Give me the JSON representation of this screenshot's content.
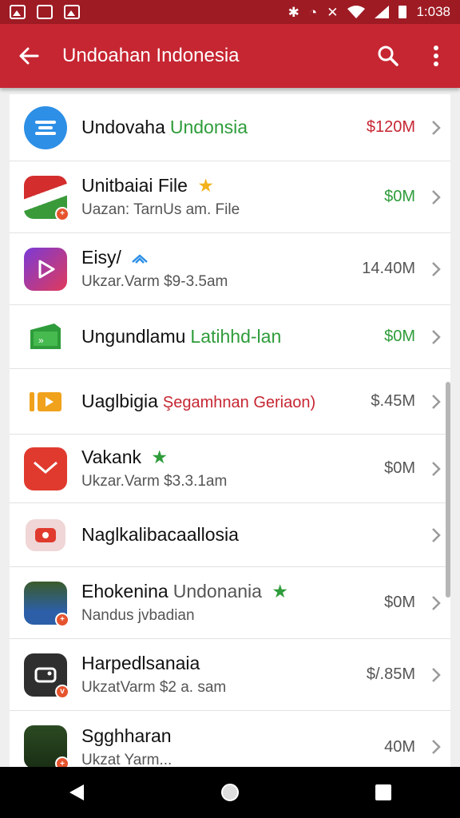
{
  "status_bar": {
    "time": "1:038",
    "icons": [
      "image-icon",
      "chat-icon",
      "photo-icon",
      "bluetooth-icon",
      "alarm-icon",
      "vibrate-icon",
      "wifi-icon",
      "signal-icon",
      "battery-icon"
    ]
  },
  "app_bar": {
    "title": "Undoahan Indonesia",
    "back_icon": "arrow-back-icon",
    "search_icon": "search-icon",
    "more_icon": "more-vert-icon",
    "color": "#c62632"
  },
  "colors": {
    "red": "#c62632",
    "green": "#2e9c3a",
    "gray": "#555555"
  },
  "rows": [
    {
      "name": "Undovaha",
      "accent": "Undonsia",
      "accent_color": "#2e9c3a",
      "sub": "",
      "value": "$120M",
      "value_color": "#c62632"
    },
    {
      "name": "Unitbaiai File",
      "accent": "",
      "accent_color": "",
      "sub": "Uazan: TarnUs am. File",
      "value": "$0M",
      "value_color": "#2e9c3a"
    },
    {
      "name": "Eisy/",
      "accent": "",
      "accent_color": "",
      "sub": "Ukzar.Varm $9-3.5am",
      "value": "14.40M",
      "value_color": "#555555"
    },
    {
      "name": "Ungundlamu",
      "accent": "Latihhd-lan",
      "accent_color": "#2e9c3a",
      "sub": "",
      "value": "$0M",
      "value_color": "#2e9c3a"
    },
    {
      "name": "Uaglbigia",
      "accent": "Şegamhnan Geriaon)",
      "accent_color": "#c62632",
      "sub": "",
      "value": "$.45M",
      "value_color": "#555555"
    },
    {
      "name": "Vakank",
      "accent": "",
      "accent_color": "",
      "sub": "Ukzar.Varm $3.3.1am",
      "value": "$0M",
      "value_color": "#555555"
    },
    {
      "name": "Naglkalibacaallosia",
      "accent": "",
      "accent_color": "",
      "sub": "",
      "value": "",
      "value_color": "#555555"
    },
    {
      "name": "Ehokenina",
      "accent": "Undonania",
      "accent_color": "#555555",
      "sub": "Nandus jvbadian",
      "value": "$0M",
      "value_color": "#555555"
    },
    {
      "name": "Harpedlsanaia",
      "accent": "",
      "accent_color": "",
      "sub": "UkzatVarm $2 a. sam",
      "value": "$/.85M",
      "value_color": "#555555"
    },
    {
      "name": "Sgghharan",
      "accent": "",
      "accent_color": "",
      "sub": "Ukzat Yarm...",
      "value": "40M",
      "value_color": "#555555"
    }
  ],
  "nav_bar": {
    "back": "back-triangle-icon",
    "home": "home-circle-icon",
    "recents": "recents-square-icon"
  }
}
